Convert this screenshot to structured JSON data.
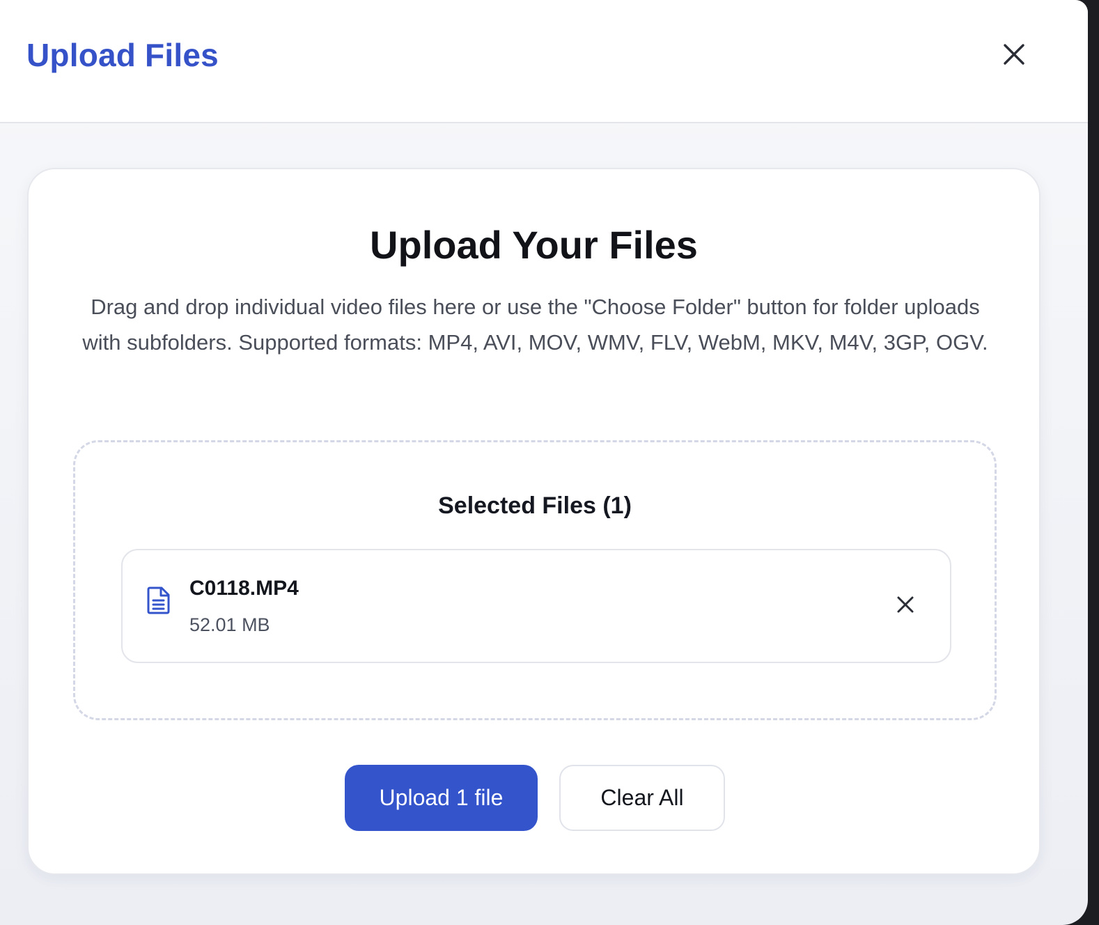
{
  "header": {
    "title": "Upload Files",
    "close_icon": "close-icon"
  },
  "card": {
    "title": "Upload Your Files",
    "description": "Drag and drop individual video files here or use the \"Choose Folder\" button for folder uploads with subfolders. Supported formats: MP4, AVI, MOV, WMV, FLV, WebM, MKV, M4V, 3GP, OGV."
  },
  "dropzone": {
    "selected_title": "Selected Files (1)",
    "files": [
      {
        "name": "C0118.MP4",
        "size": "52.01 MB",
        "icon": "file-document-icon",
        "remove_icon": "close-icon"
      }
    ]
  },
  "actions": {
    "upload_label": "Upload 1 file",
    "clear_label": "Clear All"
  },
  "colors": {
    "accent": "#3454cc",
    "title_blue": "#3552c8",
    "text_dark": "#111318",
    "text_muted": "#4a4e59",
    "dashed_border": "#d3d7e6"
  }
}
